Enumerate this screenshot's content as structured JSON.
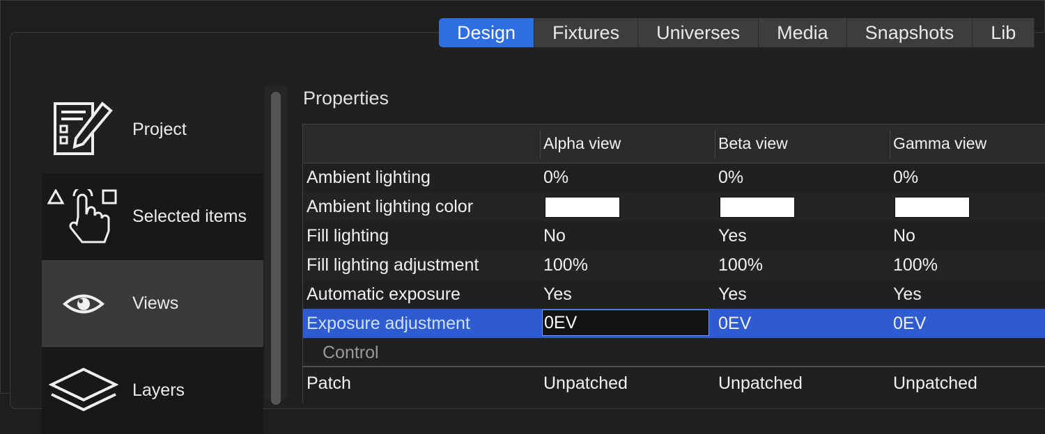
{
  "tabs": [
    "Design",
    "Fixtures",
    "Universes",
    "Media",
    "Snapshots",
    "Lib"
  ],
  "active_tab": "Design",
  "sidebar": {
    "items": [
      {
        "label": "Project",
        "icon": "project-form-icon"
      },
      {
        "label": "Selected items",
        "icon": "touch-select-icon"
      },
      {
        "label": "Views",
        "icon": "eye-icon"
      },
      {
        "label": "Layers",
        "icon": "layers-icon"
      }
    ]
  },
  "properties": {
    "title": "Properties",
    "columns": [
      "Alpha view",
      "Beta view",
      "Gamma view"
    ],
    "rows": [
      {
        "label": "Ambient lighting",
        "values": [
          "0%",
          "0%",
          "0%"
        ]
      },
      {
        "label": "Ambient lighting color",
        "values": [
          "",
          "",
          ""
        ],
        "swatch_color": "#ffffff"
      },
      {
        "label": "Fill lighting",
        "values": [
          "No",
          "Yes",
          "No"
        ]
      },
      {
        "label": "Fill lighting adjustment",
        "values": [
          "100%",
          "100%",
          "100%"
        ]
      },
      {
        "label": "Automatic exposure",
        "values": [
          "Yes",
          "Yes",
          "Yes"
        ]
      },
      {
        "label": "Exposure adjustment",
        "values": [
          "0EV",
          "0EV",
          "0EV"
        ],
        "selected": true
      }
    ],
    "section": "Control",
    "control_rows": [
      {
        "label": "Patch",
        "values": [
          "Unpatched",
          "Unpatched",
          "Unpatched"
        ]
      }
    ]
  },
  "colors": {
    "accent": "#2f6ee0",
    "selection": "#2f5bd0",
    "background": "#1e1e1e"
  }
}
